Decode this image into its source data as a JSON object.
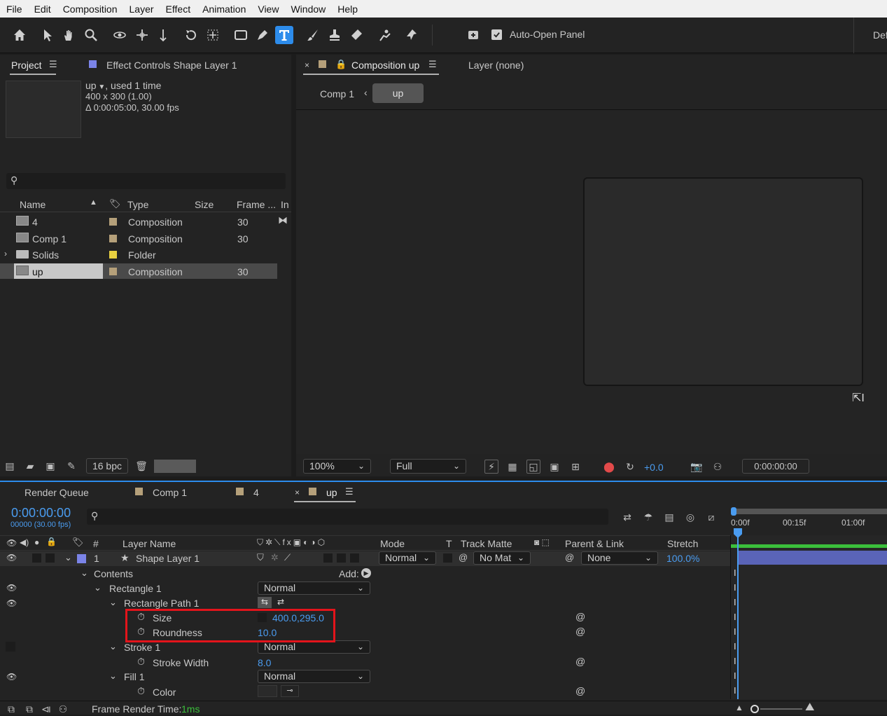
{
  "menu": [
    "File",
    "Edit",
    "Composition",
    "Layer",
    "Effect",
    "Animation",
    "View",
    "Window",
    "Help"
  ],
  "toolbar": {
    "tools": [
      "home-icon",
      "selection-icon",
      "hand-icon",
      "zoom-icon",
      "orbit-icon",
      "pan-icon",
      "dolly-icon",
      "rotate-icon",
      "anchor-icon",
      "rectangle-icon",
      "pen-icon",
      "type-icon",
      "brush-icon",
      "stamp-icon",
      "eraser-icon",
      "roto-icon",
      "puppet-icon"
    ],
    "auto_open_label": "Auto-Open Panel",
    "workspace_label": "Def"
  },
  "project_panel": {
    "tab_project": "Project",
    "tab_effect_controls": "Effect Controls Shape Layer 1",
    "selected_name": "up",
    "used": ", used 1 time",
    "dimensions": "400 x 300 (1.00)",
    "duration": "Δ 0:00:05:00, 30.00 fps",
    "search_placeholder": "",
    "columns": {
      "name": "Name",
      "type": "Type",
      "size": "Size",
      "frame": "Frame ...",
      "in": "In"
    },
    "items": [
      {
        "name": "4",
        "type": "Composition",
        "frame": "30",
        "color": "#b5a07a"
      },
      {
        "name": "Comp 1",
        "type": "Composition",
        "frame": "30",
        "color": "#b5a07a"
      },
      {
        "name": "Solids",
        "type": "Folder",
        "frame": "",
        "color": "#e8d040"
      },
      {
        "name": "up",
        "type": "Composition",
        "frame": "30",
        "color": "#b5a07a"
      }
    ],
    "bpc": "16 bpc"
  },
  "comp_panel": {
    "tab_label": "Composition up",
    "layer_tab": "Layer (none)",
    "breadcrumb_parent": "Comp 1",
    "breadcrumb_current": "up",
    "zoom": "100%",
    "resolution": "Full",
    "exposure": "+0.0",
    "timecode": "0:00:00:00"
  },
  "timeline": {
    "tabs": [
      {
        "label": "Render Queue",
        "color": ""
      },
      {
        "label": "Comp 1",
        "color": "#b5a07a"
      },
      {
        "label": "4",
        "color": "#b5a07a"
      },
      {
        "label": "up",
        "color": "#b5a07a"
      }
    ],
    "timecode": "0:00:00:00",
    "fps_info": "00000 (30.00 fps)",
    "headers": {
      "num": "#",
      "layer_name": "Layer Name",
      "mode": "Mode",
      "t": "T",
      "track_matte": "Track Matte",
      "parent": "Parent & Link",
      "stretch": "Stretch"
    },
    "ruler": [
      "0:00f",
      "00:15f",
      "01:00f"
    ],
    "layer": {
      "num": "1",
      "name": "Shape Layer 1",
      "mode": "Normal",
      "matte": "No Mat",
      "parent": "None",
      "stretch": "100.0%"
    },
    "contents_label": "Contents",
    "add_label": "Add:",
    "props": {
      "rect": "Rectangle 1",
      "rect_mode": "Normal",
      "rect_path": "Rectangle Path 1",
      "size_label": "Size",
      "size_value": "400.0,295.0",
      "roundness_label": "Roundness",
      "roundness_value": "10.0",
      "stroke": "Stroke 1",
      "stroke_mode": "Normal",
      "stroke_width_label": "Stroke Width",
      "stroke_width_value": "8.0",
      "fill": "Fill 1",
      "fill_mode": "Normal",
      "color_label": "Color"
    },
    "frame_render_label": "Frame Render Time:",
    "frame_render_value": "1ms"
  },
  "colors": {
    "accent": "#2d8ceb",
    "highlight": "#e3141b",
    "layer_label": "#7b84e8",
    "layer_bar": "#5a64b8",
    "work_area": "#3bbf3b"
  }
}
